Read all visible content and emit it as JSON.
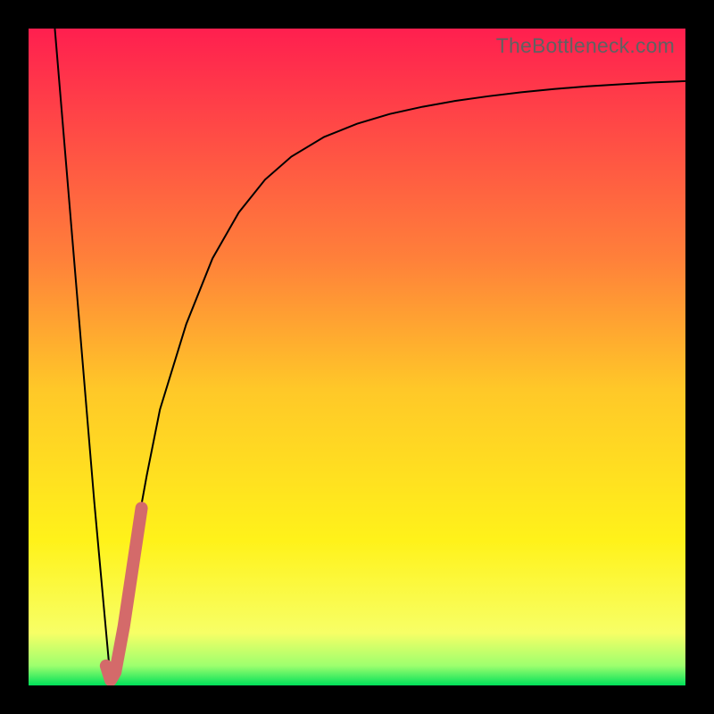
{
  "watermark": "TheBottleneck.com",
  "chart_data": {
    "type": "line",
    "title": "",
    "xlabel": "",
    "ylabel": "",
    "xlim": [
      0,
      100
    ],
    "ylim": [
      0,
      100
    ],
    "legend": false,
    "grid": false,
    "background_gradient_stops": [
      {
        "offset": 0,
        "color": "#ff1f4f"
      },
      {
        "offset": 0.35,
        "color": "#ff803a"
      },
      {
        "offset": 0.55,
        "color": "#ffc828"
      },
      {
        "offset": 0.78,
        "color": "#fff21a"
      },
      {
        "offset": 0.92,
        "color": "#f7ff66"
      },
      {
        "offset": 0.97,
        "color": "#9dff6e"
      },
      {
        "offset": 1.0,
        "color": "#00e05a"
      }
    ],
    "series": [
      {
        "name": "bottleneck-curve",
        "stroke": "#000000",
        "stroke_width": 2,
        "x": [
          4.0,
          6.0,
          8.0,
          10.0,
          12.0,
          12.5,
          13.0,
          14.0,
          16.0,
          18.0,
          20.0,
          24.0,
          28.0,
          32.0,
          36.0,
          40.0,
          45.0,
          50.0,
          55.0,
          60.0,
          65.0,
          70.0,
          75.0,
          80.0,
          85.0,
          90.0,
          95.0,
          100.0
        ],
        "y": [
          100.0,
          76.0,
          52.0,
          28.0,
          6.0,
          0.5,
          2.0,
          8.0,
          21.0,
          32.0,
          42.0,
          55.0,
          65.0,
          72.0,
          77.0,
          80.5,
          83.5,
          85.5,
          87.0,
          88.1,
          89.0,
          89.7,
          90.3,
          90.8,
          91.2,
          91.5,
          91.8,
          92.0
        ]
      },
      {
        "name": "highlight-segment",
        "stroke": "#d46a6a",
        "stroke_width": 14,
        "linecap": "round",
        "x": [
          11.8,
          12.5,
          13.2,
          14.5,
          16.0,
          17.2
        ],
        "y": [
          3.0,
          0.8,
          2.0,
          9.0,
          19.0,
          27.0
        ]
      }
    ]
  }
}
